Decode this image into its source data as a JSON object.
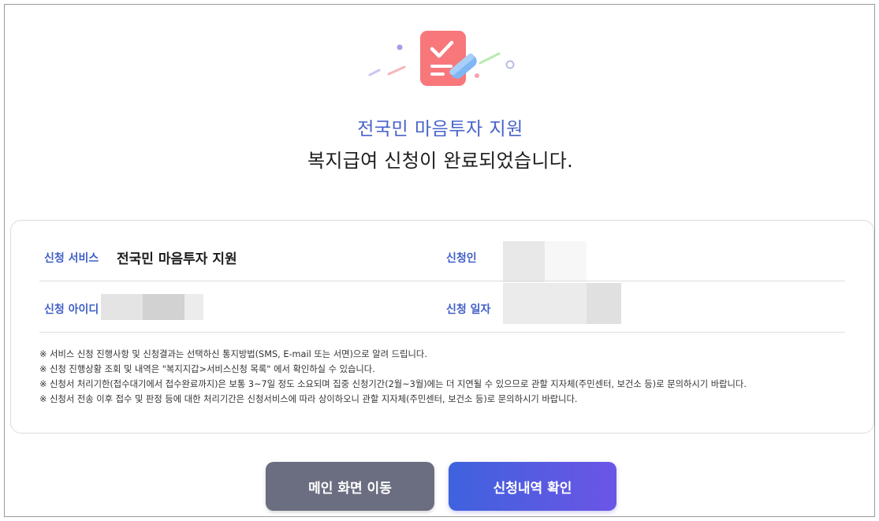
{
  "header": {
    "service_title": "전국민 마음투자 지원",
    "completion_message": "복지급여 신청이 완료되었습니다."
  },
  "details": {
    "service_label": "신청 서비스",
    "service_value": "전국민 마음투자 지원",
    "applicant_label": "신청인",
    "applicant_id_label": "신청 아이디",
    "date_label": "신청 일자"
  },
  "notes": [
    "※ 서비스 신청 진행사항 및 신청결과는 선택하신 통지방법(SMS, E-mail 또는 서면)으로 알려 드립니다.",
    "※ 신청 진행상황 조회 및 내역은 \"복지지갑>서비스신청 목록\" 에서 확인하실 수 있습니다.",
    "※ 신청서 처리기한(접수대기에서 접수완료까지)은 보통 3~7일 정도 소요되며 집중 신청기간(2월~3월)에는 더 지연될 수 있으므로 관할 지자체(주민센터, 보건소 등)로 문의하시기 바랍니다.",
    "※ 신청서 전송 이후 접수 및 판정 등에 대한 처리기간은 신청서비스에 따라 상이하오니 관할 지자체(주민센터, 보건소 등)로 문의하시기 바랍니다."
  ],
  "buttons": {
    "main_label": "메인 화면 이동",
    "history_label": "신청내역 확인"
  },
  "icons": {
    "hero": "clipboard-check-pencil-icon"
  },
  "colors": {
    "accent_blue": "#4763c9",
    "gray_button": "#6b6e80",
    "gradient_start": "#3f62dd",
    "gradient_end": "#6c55e6"
  }
}
